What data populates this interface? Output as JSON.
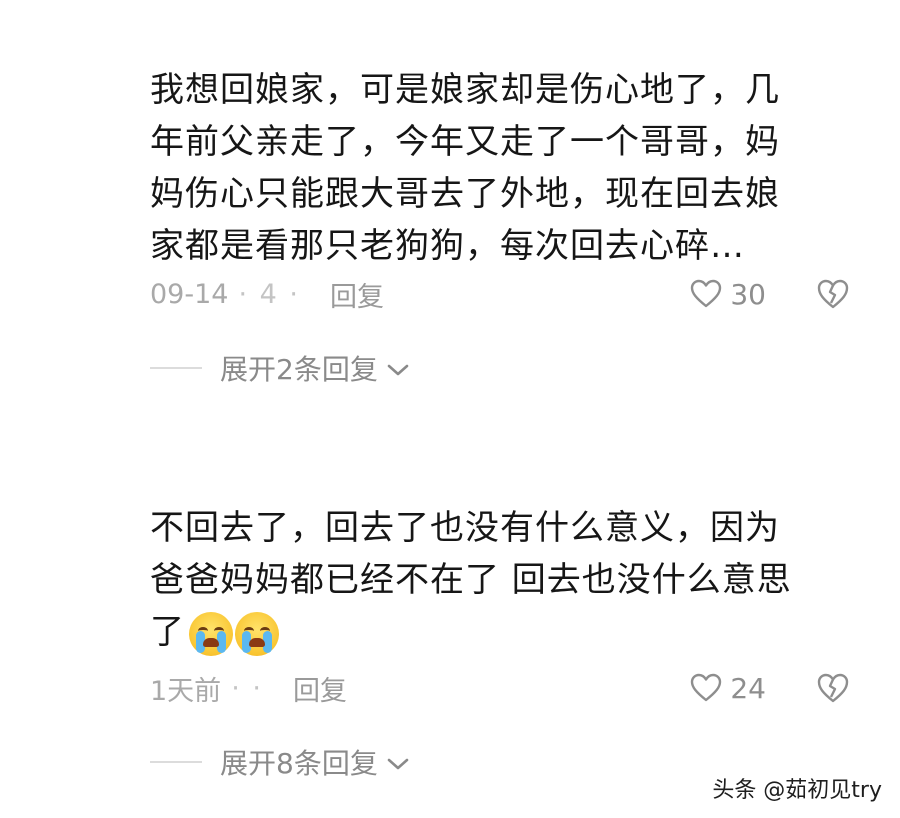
{
  "comments": [
    {
      "text": "我想回娘家，可是娘家却是伤心地了，几\n年前父亲走了，今年又走了一个哥哥，妈\n妈伤心只能跟大哥去了外地，现在回去娘\n家都是看那只老狗狗，每次回去心碎…",
      "time": "09-14",
      "dots": "· 4 · ",
      "reply_label": "回复",
      "likes": "30",
      "expand_label": "展开2条回复"
    },
    {
      "text": "不回去了，回去了也没有什么意义，因为\n爸爸妈妈都已经不在了 回去也没什么意思\n了",
      "emoji_icon": "loudly-crying-face",
      "time": "1天前",
      "dots": "· · ",
      "reply_label": "回复",
      "likes": "24",
      "expand_label": "展开8条回复"
    }
  ],
  "watermark": "头条 @茹初见try"
}
